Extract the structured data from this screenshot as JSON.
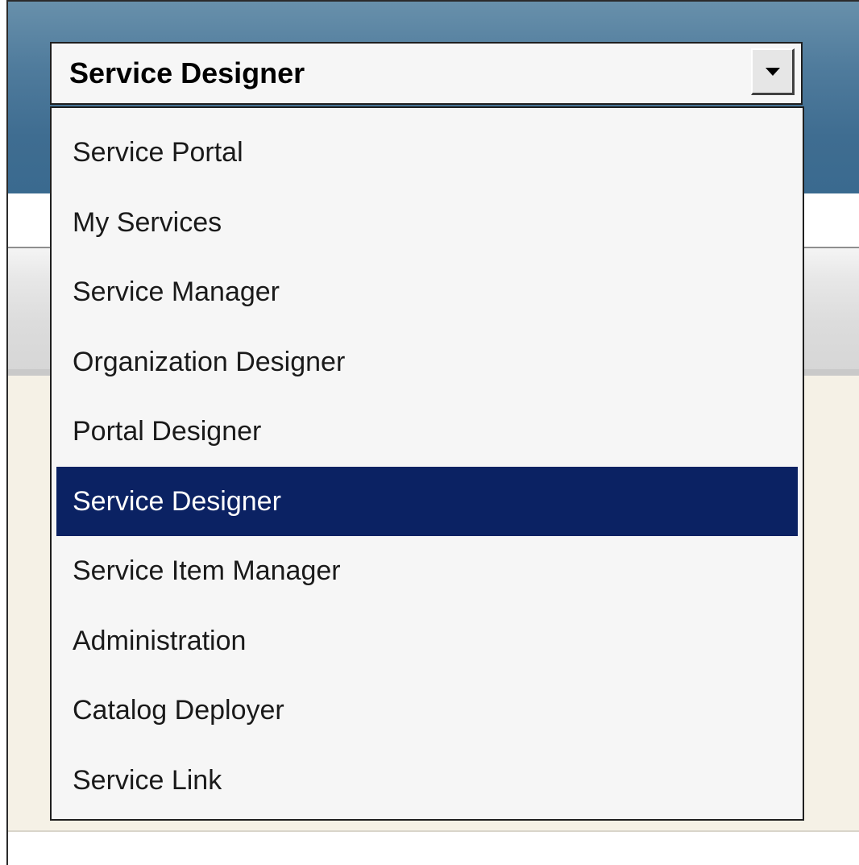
{
  "selector": {
    "current_value": "Service Designer"
  },
  "dropdown": {
    "options": [
      {
        "label": "Service Portal",
        "selected": false
      },
      {
        "label": "My Services",
        "selected": false
      },
      {
        "label": "Service Manager",
        "selected": false
      },
      {
        "label": "Organization Designer",
        "selected": false
      },
      {
        "label": "Portal Designer",
        "selected": false
      },
      {
        "label": "Service Designer",
        "selected": true
      },
      {
        "label": "Service Item Manager",
        "selected": false
      },
      {
        "label": "Administration",
        "selected": false
      },
      {
        "label": "Catalog Deployer",
        "selected": false
      },
      {
        "label": "Service Link",
        "selected": false
      }
    ]
  },
  "icons": {
    "dropdown_arrow": "chevron-down-icon"
  },
  "colors": {
    "header": "#3f6d91",
    "selected_option_bg": "#0b2263",
    "selected_option_text": "#ffffff",
    "content_bg": "#f5f1e6"
  }
}
